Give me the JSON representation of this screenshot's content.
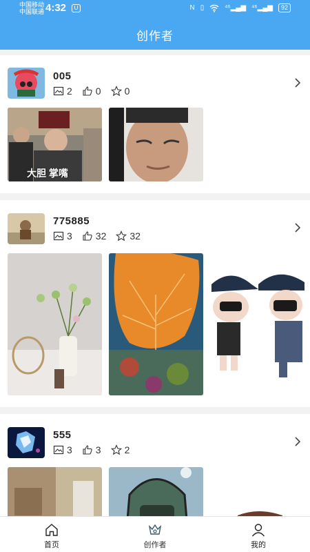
{
  "status": {
    "carrier1": "中国移动",
    "carrier2": "中国联通",
    "time": "4:32",
    "notif": "U",
    "net1": "⁴⁶",
    "net2": "⁴⁶",
    "battery": "92"
  },
  "header": {
    "title": "创作者"
  },
  "creators": [
    {
      "name": "005",
      "images": "2",
      "likes": "0",
      "stars": "0",
      "thumb_text": "大胆 掌嘴"
    },
    {
      "name": "775885",
      "images": "3",
      "likes": "32",
      "stars": "32"
    },
    {
      "name": "555",
      "images": "3",
      "likes": "3",
      "stars": "2"
    }
  ],
  "tabs": [
    {
      "label": "首页",
      "icon": "home-icon"
    },
    {
      "label": "创作者",
      "icon": "creator-icon"
    },
    {
      "label": "我的",
      "icon": "profile-icon"
    }
  ],
  "colors": {
    "header": "#4aa8f2",
    "background": "#f2f2f2"
  }
}
